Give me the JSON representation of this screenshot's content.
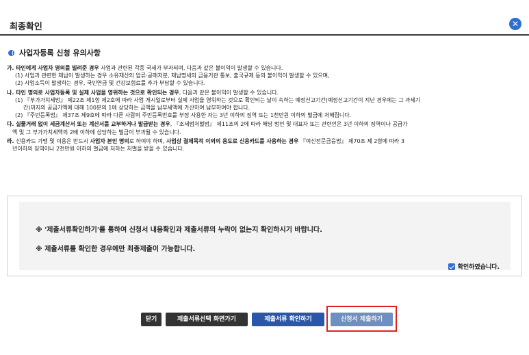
{
  "header": {
    "title": "최종확인",
    "close_glyph": "✕"
  },
  "section": {
    "title": "사업자등록 신청 유의사항"
  },
  "notice": {
    "ga": {
      "prefix": "가. ",
      "bold": "타인에게 사업자 명의를 빌려준 경우",
      "rest": " 사업과 관련된 각종 국세가 부과되며, 다음과 같은 불이익이 발생할 수 있습니다.",
      "items": [
        "(1) 사업과 관련한 체납이 발생하는 경우 소유재산의 압류·공매처분, 체납명세의 금융기관 통보, 출국규제 등의 불이익이 발생할 수 있으며,",
        "(2) 사업소득이 발생하는 경우, 국민연금 및 건강보험료를 추가 부담할 수 있습니다."
      ]
    },
    "na": {
      "prefix": "나. ",
      "bold": "타인 명의로 사업자등록 및 실제 사업을 영위하는 것으로 확인되는 경우",
      "rest": ", 다음과 같은 불이익이 발생할 수 있습니다.",
      "item1": "(1) 『부가가치세법』 제22조 제1항 제2호에 따라 사업 개시일로부터 실제 사업을 영위하는 것으로 확인되는 날이 속하는 예정신고기간(예정신고기간이 지난 경우에는 그 과세기",
      "item1_cont": "간)까지의 공급가액에 대해 100분의 1에 상당하는 금액을 납부세액에 가산하여 납부하여야 합니다.",
      "item2": "(2) 『주민등록법』 제37조 제9호에 따라 다른 사람의 주민등록번호를 부정 사용한 자는 3년 이하의 징역 또는 1천만원 이하의 벌금에 처해집니다."
    },
    "da": {
      "prefix": "다. ",
      "bold": "실물거래 없이 세금계산서 또는 계산서를 교부하거나 발급받는 경우",
      "rest": ", 『조세범처벌법』 제11조의 2에 따라 해당 법인 및 대표자 또는 관련인은 3년 이하의 징역이나 공급가",
      "cont": "액 및 그 부가가치세액의 2배 이하에 상당하는 벌금이 부과될 수 있습니다."
    },
    "ra": {
      "prefix": "라. ",
      "text1": "신용카드 가맹 및 이용은 반드시 ",
      "bold1": "사업자 본인 명의",
      "text2": "로 하여야 하며, ",
      "bold2": "사업상 결제목적 이외의 용도로 신용카드를 사용하는 경우",
      "text3": " 『여신전문금융법』 제70조 제 2항에 따라 3",
      "cont": "년이하의 징역이나 2천만원 이하의 벌금에 처하는 처벌을 받을 수 있습니다."
    }
  },
  "confirm": {
    "line1": "※  '제출서류확인하기'를 통하여 신청서 내용확인과 제출서류의 누락이 없는지 확인하시기 바랍니다.",
    "line2": "※  제출서류를 확인한 경우에만 최종제출이 가능합니다.",
    "checkbox_label": "확인하였습니다.",
    "checked": true
  },
  "buttons": {
    "close": "닫기",
    "doc_select": "제출서류선택 화면가기",
    "doc_check": "제출서류 확인하기",
    "submit": "신청서 제출하기"
  },
  "colors": {
    "accent": "#2f6fd0",
    "highlight": "#e02020"
  }
}
